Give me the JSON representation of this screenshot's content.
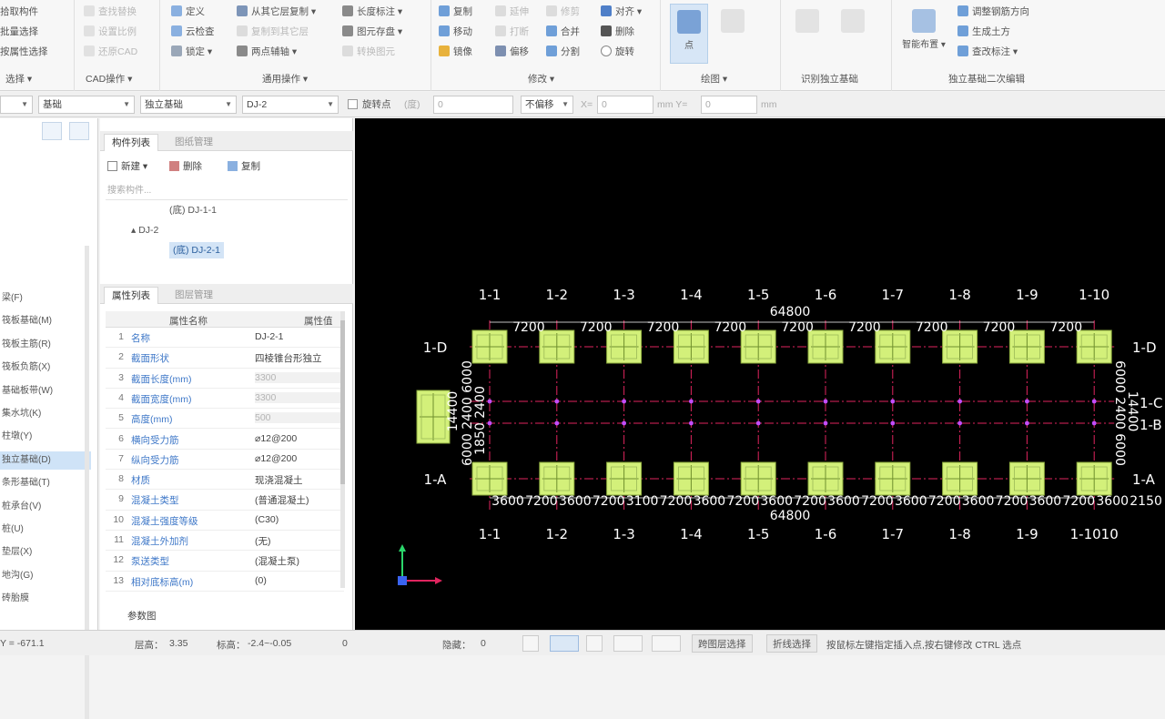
{
  "ribbon": {
    "group1": {
      "items": [
        "拾取构件",
        "批量选择",
        "按属性选择"
      ],
      "label": "选择"
    },
    "group_cad": {
      "items": [
        "查找替换",
        "设置比例",
        "还原CAD"
      ],
      "label": "CAD操作"
    },
    "group_common": {
      "items": [
        "定义",
        "云检查",
        "锁定",
        "从其它层复制",
        "复制到其它层",
        "两点辅轴",
        "长度标注",
        "图元存盘",
        "转换图元"
      ],
      "label": "通用操作"
    },
    "group_modify": {
      "items": [
        "复制",
        "移动",
        "镜像",
        "延伸",
        "打断",
        "偏移",
        "修剪",
        "合并",
        "分割",
        "对齐",
        "删除",
        "旋转"
      ],
      "label": "修改"
    },
    "group_draw": {
      "button": "点",
      "label": "绘图"
    },
    "group_identify": {
      "label": "识别独立基础"
    },
    "group_smart": {
      "button": "智能布置",
      "items": [
        "调整钢筋方向",
        "生成土方",
        "查改标注"
      ],
      "label": "独立基础二次编辑"
    }
  },
  "propbar": {
    "combo0": "",
    "combo1": "基础",
    "combo2": "独立基础",
    "combo3": "DJ-2",
    "checkbox_label": "旋转点",
    "angle_hint": "(度)",
    "angle_value": "0",
    "mode": "不偏移",
    "x_label": "X=",
    "x_value": "0",
    "y_label": "mm Y=",
    "y_value": "0",
    "unit": "mm"
  },
  "leftstrip": {
    "items": [
      {
        "label": "梁(F)",
        "selected": false
      },
      {
        "label": "筏板基础(M)",
        "selected": false
      },
      {
        "label": "筏板主筋(R)",
        "selected": false
      },
      {
        "label": "筏板负筋(X)",
        "selected": false
      },
      {
        "label": "基础板带(W)",
        "selected": false
      },
      {
        "label": "集水坑(K)",
        "selected": false
      },
      {
        "label": "柱墩(Y)",
        "selected": false
      },
      {
        "label": "独立基础(D)",
        "selected": true
      },
      {
        "label": "条形基础(T)",
        "selected": false
      },
      {
        "label": "桩承台(V)",
        "selected": false
      },
      {
        "label": "桩(U)",
        "selected": false
      },
      {
        "label": "垫层(X)",
        "selected": false
      },
      {
        "label": "地沟(G)",
        "selected": false
      },
      {
        "label": "砖胎膜",
        "selected": false
      }
    ]
  },
  "component_list": {
    "tab_active": "构件列表",
    "tab_inactive": "图纸管理",
    "new_btn": "新建",
    "delete_btn": "删除",
    "copy_btn": "复制",
    "search_placeholder": "搜索构件...",
    "tree": [
      {
        "label": "(底) DJ-1-1",
        "indent": 2,
        "selected": false
      },
      {
        "label": "▴ DJ-2",
        "indent": 1,
        "selected": false
      },
      {
        "label": "(底) DJ-2-1",
        "indent": 2,
        "selected": true
      }
    ]
  },
  "properties": {
    "tab_active": "属性列表",
    "tab_inactive": "图层管理",
    "col_name": "属性名称",
    "col_value": "属性值",
    "rows": [
      {
        "n": "1",
        "name": "名称",
        "value": "DJ-2-1",
        "dim": false
      },
      {
        "n": "2",
        "name": "截面形状",
        "value": "四棱锥台形独立",
        "dim": false
      },
      {
        "n": "3",
        "name": "截面长度(mm)",
        "value": "3300",
        "dim": true
      },
      {
        "n": "4",
        "name": "截面宽度(mm)",
        "value": "3300",
        "dim": true
      },
      {
        "n": "5",
        "name": "高度(mm)",
        "value": "500",
        "dim": true
      },
      {
        "n": "6",
        "name": "横向受力筋",
        "value": "⌀12@200",
        "dim": false
      },
      {
        "n": "7",
        "name": "纵向受力筋",
        "value": "⌀12@200",
        "dim": false
      },
      {
        "n": "8",
        "name": "材质",
        "value": "现浇混凝土",
        "dim": false
      },
      {
        "n": "9",
        "name": "混凝土类型",
        "value": "(普通混凝土)",
        "dim": false
      },
      {
        "n": "10",
        "name": "混凝土强度等级",
        "value": "(C30)",
        "dim": false
      },
      {
        "n": "11",
        "name": "混凝土外加剂",
        "value": "(无)",
        "dim": false
      },
      {
        "n": "12",
        "name": "泵送类型",
        "value": "(混凝土泵)",
        "dim": false
      },
      {
        "n": "13",
        "name": "相对底标高(m)",
        "value": "(0)",
        "dim": false
      }
    ],
    "param_btn": "参数图"
  },
  "canvas": {
    "top_axes": [
      "1-1",
      "1-2",
      "1-3",
      "1-4",
      "1-5",
      "1-6",
      "1-7",
      "1-8",
      "1-9",
      "1-10"
    ],
    "bottom_axes": [
      "1-1",
      "1-2",
      "1-3",
      "1-4",
      "1-5",
      "1-6",
      "1-7",
      "1-8",
      "1-9",
      "1-1010"
    ],
    "left_axes": [
      "1-D",
      "1-A"
    ],
    "right_axes": [
      "1-D",
      "1-C",
      "1-B",
      "1-A"
    ],
    "total_top": "64800",
    "total_bottom": "64800",
    "spacing": "7200",
    "bottom_dims": [
      "3600",
      "7200",
      "3600",
      "7200",
      "3100",
      "7200",
      "3600",
      "7200",
      "3600",
      "7200",
      "3600",
      "7200",
      "3600",
      "7200",
      "3600",
      "7200",
      "3600",
      "7200",
      "3600",
      "2150"
    ],
    "left_dims": "6000 2400 6000",
    "left_total": "14400",
    "left_mid": "1850 2400",
    "right_dims": "6000 2400 6000",
    "right_total": "14400",
    "colors": {
      "footing": "#d3f07a",
      "axis": "#e0245e",
      "text": "#ffffff",
      "footing_edge": "#8aa83c"
    }
  },
  "statusbar": {
    "coord": "Y = -671.1",
    "floor_label": "层高：",
    "floor_value": "3.35",
    "elev_label": "标高：",
    "elev_value": "-2.4~-0.05",
    "count": "0",
    "hidden_label": "隐藏：",
    "hidden_value": "0",
    "btn_cross": "跨图层选择",
    "btn_bend": "折线选择",
    "hint": "按鼠标左键指定插入点,按右键修改 CTRL 选点"
  }
}
